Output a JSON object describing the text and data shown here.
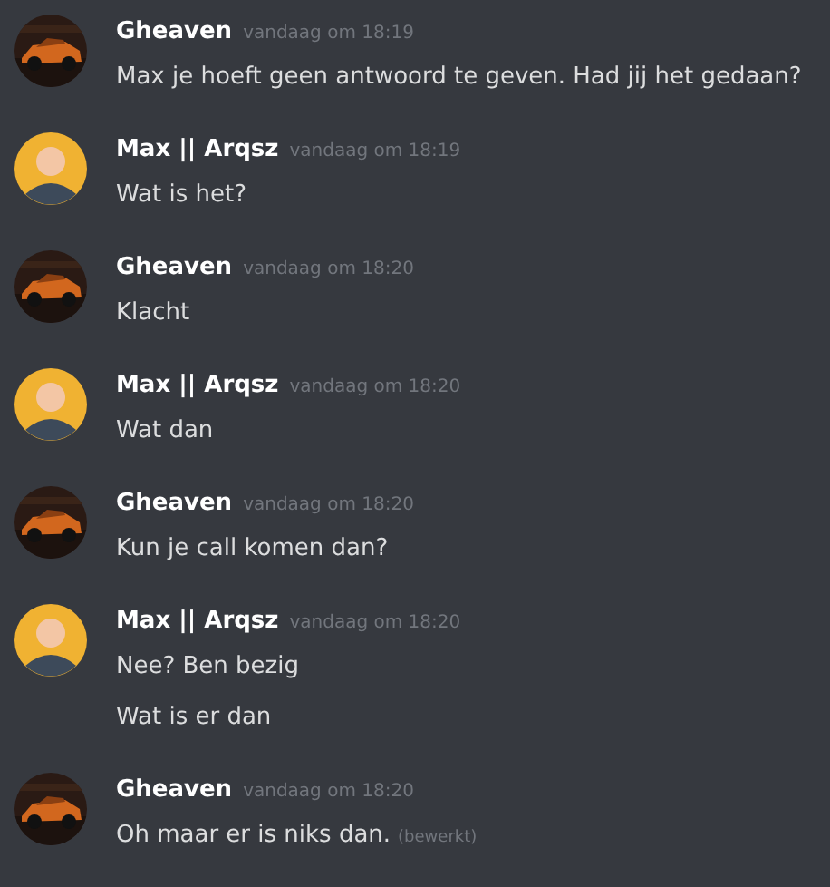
{
  "messages": [
    {
      "author": "Gheaven",
      "avatar": {
        "kind": "picture"
      },
      "timestamp": "vandaag om 18:19",
      "lines": [
        {
          "text": "Max je hoeft geen antwoord te geven. Had jij het gedaan?"
        }
      ]
    },
    {
      "author": "Max || Arqsz",
      "avatar": {
        "kind": "cartoon"
      },
      "timestamp": "vandaag om 18:19",
      "lines": [
        {
          "text": "Wat is het?"
        }
      ]
    },
    {
      "author": "Gheaven",
      "avatar": {
        "kind": "picture"
      },
      "timestamp": "vandaag om 18:20",
      "lines": [
        {
          "text": "Klacht"
        }
      ]
    },
    {
      "author": "Max || Arqsz",
      "avatar": {
        "kind": "cartoon"
      },
      "timestamp": "vandaag om 18:20",
      "lines": [
        {
          "text": "Wat dan"
        }
      ]
    },
    {
      "author": "Gheaven",
      "avatar": {
        "kind": "picture"
      },
      "timestamp": "vandaag om 18:20",
      "lines": [
        {
          "text": "Kun je call komen dan?"
        }
      ]
    },
    {
      "author": "Max || Arqsz",
      "avatar": {
        "kind": "cartoon"
      },
      "timestamp": "vandaag om 18:20",
      "lines": [
        {
          "text": "Nee? Ben bezig"
        },
        {
          "text": "Wat is er dan"
        }
      ]
    },
    {
      "author": "Gheaven",
      "avatar": {
        "kind": "picture"
      },
      "timestamp": "vandaag om 18:20",
      "lines": [
        {
          "text": "Oh maar er is niks dan.",
          "edited": "(bewerkt)"
        }
      ]
    }
  ]
}
